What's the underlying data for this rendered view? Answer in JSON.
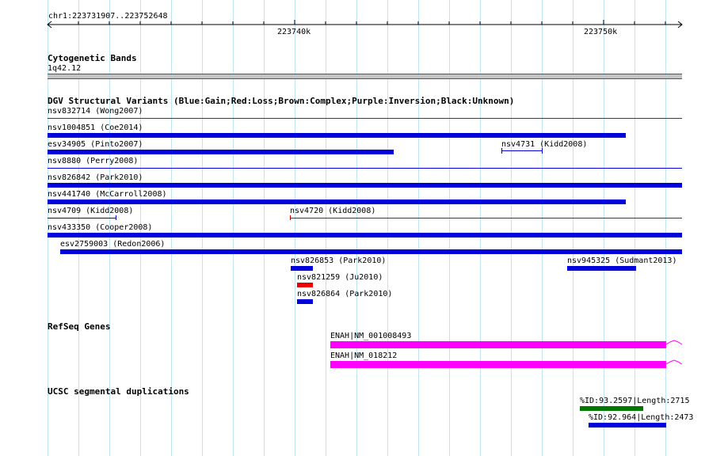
{
  "ruler": {
    "position": "chr1:223731907..223752648",
    "ticks": [
      "223740k",
      "223750k"
    ]
  },
  "tracks": {
    "cytoband": {
      "title": "Cytogenetic Bands",
      "band": "1q42.12"
    },
    "dgv": {
      "title": "DGV Structural Variants (Blue:Gain;Red:Loss;Brown:Complex;Purple:Inversion;Black:Unknown)",
      "features": [
        {
          "label": "nsv832714 (Wong2007)",
          "color": "#cc0000",
          "style": "line"
        },
        {
          "label": "nsv1004851 (Coe2014)",
          "color": "#0000dd",
          "style": "bar"
        },
        {
          "label": "esv34905 (Pinto2007)",
          "color": "#0000dd",
          "style": "bar"
        },
        {
          "label": "nsv4731 (Kidd2008)",
          "color": "#0000dd",
          "style": "bracket"
        },
        {
          "label": "nsv8880 (Perry2008)",
          "color": "#0000dd",
          "style": "line"
        },
        {
          "label": "nsv826842 (Park2010)",
          "color": "#0000dd",
          "style": "bar"
        },
        {
          "label": "nsv441740 (McCarroll2008)",
          "color": "#0000dd",
          "style": "bar"
        },
        {
          "label": "nsv4709 (Kidd2008)",
          "color": "#0000dd",
          "style": "line"
        },
        {
          "label": "nsv4720 (Kidd2008)",
          "color": "#cc0000",
          "style": "line"
        },
        {
          "label": "nsv433350 (Cooper2008)",
          "color": "#0000dd",
          "style": "bar"
        },
        {
          "label": "esv2759003 (Redon2006)",
          "color": "#0000dd",
          "style": "bar"
        },
        {
          "label": "nsv826853 (Park2010)",
          "color": "#0000dd",
          "style": "bar"
        },
        {
          "label": "nsv945325 (Sudmant2013)",
          "color": "#0000dd",
          "style": "bar"
        },
        {
          "label": "nsv821259 (Ju2010)",
          "color": "#ee0000",
          "style": "bar"
        },
        {
          "label": "nsv826864 (Park2010)",
          "color": "#0000dd",
          "style": "bar"
        }
      ]
    },
    "refseq": {
      "title": "RefSeq Genes",
      "features": [
        {
          "label": "ENAH|NM_001008493",
          "color": "#ff00ff"
        },
        {
          "label": "ENAH|NM_018212",
          "color": "#ff00ff"
        }
      ]
    },
    "segdups": {
      "title": "UCSC segmental duplications",
      "features": [
        {
          "label": "%ID:93.2597|Length:2715",
          "color": "#007700"
        },
        {
          "label": "%ID:92.964|Length:2473",
          "color": "#0000dd"
        }
      ]
    }
  }
}
